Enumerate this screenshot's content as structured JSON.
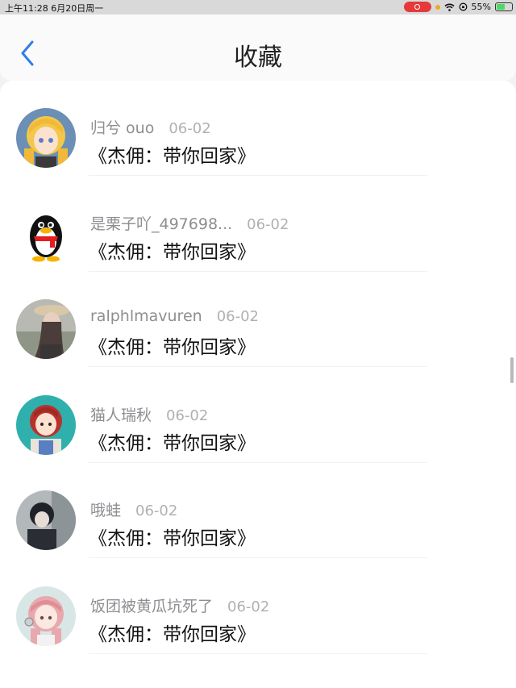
{
  "status_bar": {
    "time": "上午11:28  6月20日周一",
    "battery": "55%",
    "battery_level": 0.55
  },
  "header": {
    "title": "收藏",
    "back_icon": "chevron-left-icon"
  },
  "items": [
    {
      "username": "归兮 ouo",
      "date": "06-02",
      "title": "《杰佣：带你回家》",
      "avatar": "anime-girl-blonde"
    },
    {
      "username": "是栗子吖_497698...",
      "date": "06-02",
      "title": "《杰佣：带你回家》",
      "avatar": "qq-penguin"
    },
    {
      "username": "ralphlmavuren",
      "date": "06-02",
      "title": "《杰佣：带你回家》",
      "avatar": "photo-girl-hat"
    },
    {
      "username": "猫人瑞秋",
      "date": "06-02",
      "title": "《杰佣：带你回家》",
      "avatar": "anime-girl-redhair"
    },
    {
      "username": "哦蛙",
      "date": "06-02",
      "title": "《杰佣：带你回家》",
      "avatar": "anime-dark"
    },
    {
      "username": "饭团被黄瓜坑死了",
      "date": "06-02",
      "title": "《杰佣：带你回家》",
      "avatar": "anime-girl-pink"
    }
  ],
  "colors": {
    "accent": "#2f7fe6",
    "username": "#8e8e93",
    "date": "#b0b0b5"
  }
}
